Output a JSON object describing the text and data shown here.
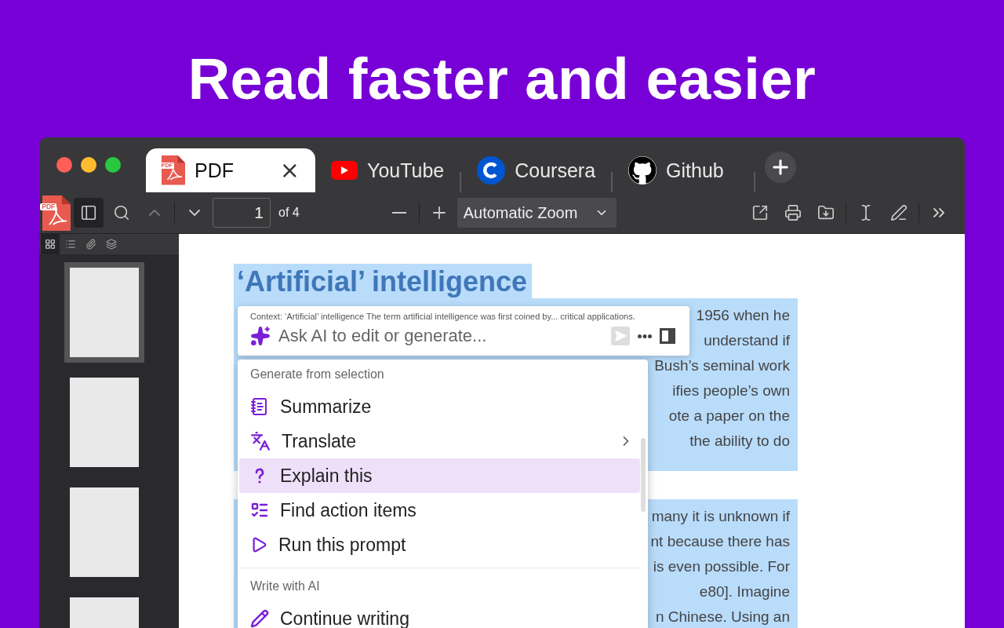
{
  "headline": "Read faster and easier",
  "tabs": [
    {
      "kind": "pdf",
      "label": "PDF",
      "badge": "PDF",
      "selected": true,
      "close": "×"
    },
    {
      "kind": "youtube",
      "label": "YouTube",
      "selected": false
    },
    {
      "kind": "coursera",
      "label": "Coursera",
      "selected": false
    },
    {
      "kind": "github",
      "label": "Github",
      "selected": false
    }
  ],
  "toolbar": {
    "app_badge": "PDF",
    "page": "1",
    "page_count": "of 4",
    "zoom": "Automatic Zoom"
  },
  "sidebar": {
    "views": [
      {
        "selected": true
      },
      {
        "selected": false
      },
      {
        "selected": false
      },
      {
        "selected": false
      }
    ],
    "thumbnails": [
      {
        "selected": true
      },
      {
        "selected": false
      },
      {
        "selected": false
      },
      {
        "selected": false
      }
    ]
  },
  "document": {
    "heading": "‘Artificial’ intelligence",
    "paragraphs": [
      [
        "1956 when he",
        "understand if",
        "Bush’s seminal work",
        "ifies people’s own",
        "ote a paper on the",
        "the ability to do"
      ],
      [
        "many it is unknown if",
        "nt because there has",
        "is even possible. For",
        "e80]. Imagine",
        "n Chinese. Using an"
      ]
    ]
  },
  "ai_prompt": {
    "context": "Context: ‘Artificial’ intelligence The term artificial intelligence was first coined by... critical applications.",
    "placeholder": "Ask AI to edit or generate..."
  },
  "menu": [
    {
      "heading": "Generate from selection",
      "items": [
        {
          "label": "Summarize",
          "selected": false,
          "submenu": false
        },
        {
          "label": "Translate",
          "selected": false,
          "submenu": true
        },
        {
          "label": "Explain this",
          "selected": true,
          "submenu": false
        },
        {
          "label": "Find action items",
          "selected": false,
          "submenu": false
        },
        {
          "label": "Run this prompt",
          "selected": false,
          "submenu": false
        }
      ]
    },
    {
      "heading": "Write with AI",
      "items": [
        {
          "label": "Continue writing",
          "selected": false,
          "submenu": false
        }
      ]
    }
  ]
}
